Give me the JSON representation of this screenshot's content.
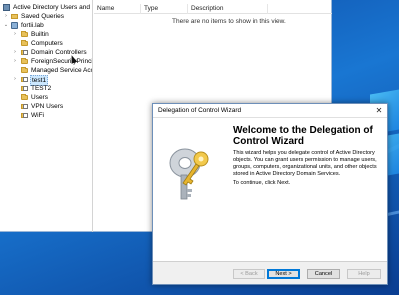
{
  "tree": {
    "root_label": "Active Directory Users and Com",
    "items": [
      {
        "label": "Saved Queries",
        "icon": "folder-icon",
        "expand": "›"
      },
      {
        "label": "fortii.lab",
        "icon": "domain-icon",
        "expand": "⌄"
      },
      {
        "label": "Builtin",
        "icon": "folder-icon",
        "expand": "›"
      },
      {
        "label": "Computers",
        "icon": "folder-icon",
        "expand": ""
      },
      {
        "label": "Domain Controllers",
        "icon": "ou-icon",
        "expand": "›"
      },
      {
        "label": "ForeignSecurityPrincipals",
        "icon": "folder-icon",
        "expand": "›"
      },
      {
        "label": "Managed Service Accoun",
        "icon": "folder-icon",
        "expand": ""
      },
      {
        "label": "test1",
        "icon": "ou-icon",
        "expand": "›"
      },
      {
        "label": "TEST2",
        "icon": "ou-icon",
        "expand": ""
      },
      {
        "label": "Users",
        "icon": "folder-icon",
        "expand": ""
      },
      {
        "label": "VPN Users",
        "icon": "ou-icon",
        "expand": ""
      },
      {
        "label": "WiFi",
        "icon": "ou-icon",
        "expand": ""
      }
    ]
  },
  "list": {
    "columns": [
      "Name",
      "Type",
      "Description"
    ],
    "empty_message": "There are no items to show in this view."
  },
  "wizard": {
    "title": "Delegation of Control Wizard",
    "close_glyph": "✕",
    "heading": "Welcome to the Delegation of Control Wizard",
    "body": "This wizard helps you delegate control of Active Directory objects. You can grant users permission to manage users, groups, computers, organizational units, and other objects stored in Active Directory Domain Services.",
    "continue_text": "To continue, click Next.",
    "buttons": {
      "back": "< Back",
      "next": "Next >",
      "cancel": "Cancel",
      "help": "Help"
    }
  },
  "colors": {
    "selection": "#cce8ff",
    "desktop": "#1565c0",
    "accent": "#0078d7"
  }
}
